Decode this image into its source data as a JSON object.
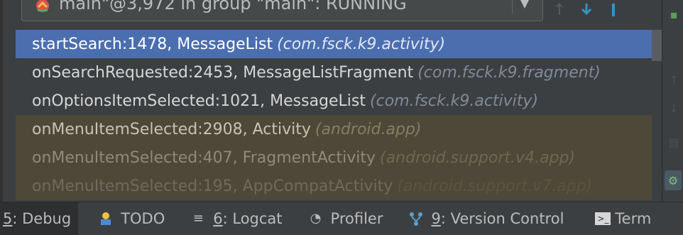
{
  "thread": {
    "selector_text": "main\"@3,972 in group \"main\": RUNNING",
    "arrow_icon": "chevron-down-icon"
  },
  "toolbar": {
    "step_over_icon": "step-over-icon",
    "step_into_icon": "step-into-icon",
    "force_step_icon": "force-step-into-icon"
  },
  "frames": [
    {
      "method": "startSearch:1478, MessageList",
      "pkg": "(com.fsck.k9.activity)",
      "state": "selected"
    },
    {
      "method": "onSearchRequested:2453, MessageListFragment",
      "pkg": "(com.fsck.k9.fragment)",
      "state": "normal"
    },
    {
      "method": "onOptionsItemSelected:1021, MessageList",
      "pkg": "(com.fsck.k9.activity)",
      "state": "normal"
    },
    {
      "method": "onMenuItemSelected:2908, Activity",
      "pkg": "(android.app)",
      "state": "library"
    },
    {
      "method": "onMenuItemSelected:407, FragmentActivity",
      "pkg": "(android.support.v4.app)",
      "state": "library"
    },
    {
      "method": "onMenuItemSelected:195, AppCompatActivity",
      "pkg": "(android.support.v7.app)",
      "state": "library"
    }
  ],
  "bottom_tabs": [
    {
      "num": "5",
      "label": ": Debug",
      "icon": "",
      "active": true
    },
    {
      "num": "",
      "label": "TODO",
      "icon": "todo-icon"
    },
    {
      "num": "6",
      "label": ": Logcat",
      "icon": "logcat-icon"
    },
    {
      "num": "",
      "label": "Profiler",
      "icon": "profiler-icon"
    },
    {
      "num": "9",
      "label": ": Version Control",
      "icon": "version-control-icon"
    },
    {
      "num": "",
      "label": "Term",
      "icon": "terminal-icon"
    }
  ],
  "colors": {
    "selected_row": "#4b6eaf",
    "library_row": "#4d4838",
    "background": "#3c3f41"
  }
}
